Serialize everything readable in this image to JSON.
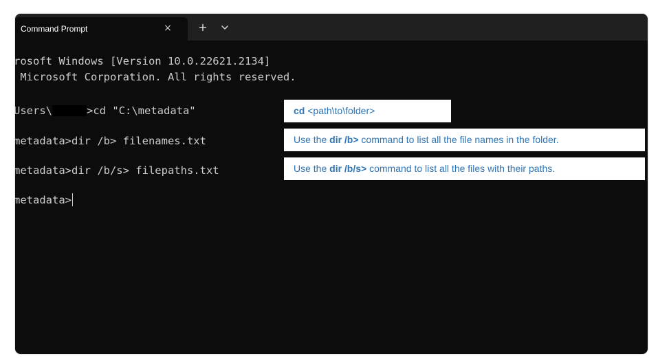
{
  "window": {
    "tab_title": "Command Prompt",
    "tab_close_icon": "×",
    "tab_add_icon": "+",
    "tab_dropdown_icon": "chevron-down-icon"
  },
  "terminal": {
    "line1": "rosoft Windows [Version 10.0.22621.2134]",
    "line2": " Microsoft Corporation. All rights reserved.",
    "line3_before": "Users\\",
    "line3_after": ">cd \"C:\\metadata\"",
    "line4": "metadata>dir /b> filenames.txt",
    "line5": "metadata>dir /b/s> filepaths.txt",
    "line6": "metadata>"
  },
  "callouts": {
    "cd": {
      "bold": "cd",
      "rest": " <path\\to\\folder>"
    },
    "dir_b": {
      "pre": "Use the ",
      "bold": "dir /b>",
      "post": " command to  list all the file names in the folder."
    },
    "dir_bs": {
      "pre": "Use the ",
      "bold": "dir /b/s>",
      "post": " command to list all the files with their paths."
    }
  },
  "colors": {
    "terminal_bg": "#0c0c0c",
    "tabbar_bg": "#202020",
    "terminal_text": "#cccccc",
    "callout_text": "#2e75b6",
    "callout_bg": "#ffffff"
  }
}
